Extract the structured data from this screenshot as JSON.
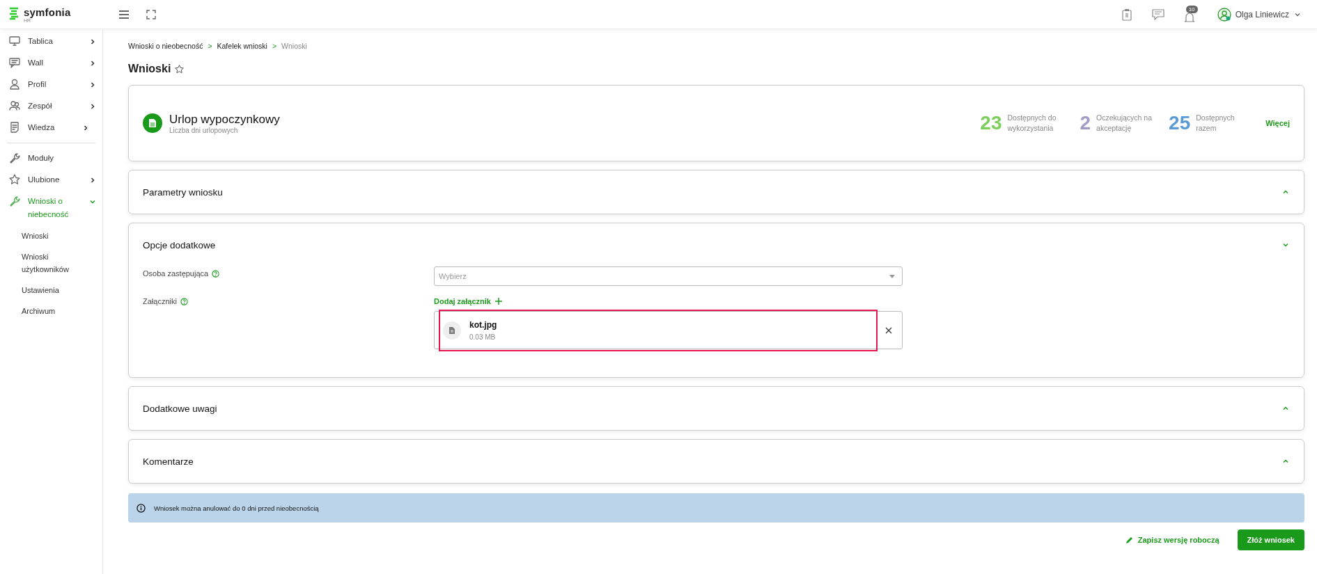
{
  "header": {
    "logo_text": "symfonia",
    "logo_sub": "HR",
    "notification_count": "10",
    "user_name": "Olga Liniewicz"
  },
  "sidebar": {
    "items": [
      {
        "label": "Tablica",
        "expandable": true,
        "expanded": false,
        "selected": false
      },
      {
        "label": "Wall",
        "expandable": true,
        "expanded": false,
        "selected": false
      },
      {
        "label": "Profil",
        "expandable": true,
        "expanded": false,
        "selected": false
      },
      {
        "label": "Zespół",
        "expandable": true,
        "expanded": false,
        "selected": false
      },
      {
        "label": "Wiedza",
        "expandable": true,
        "expanded": false,
        "selected": false,
        "divider_after": true
      },
      {
        "label": "Moduły",
        "expandable": false,
        "selected": false
      },
      {
        "label": "Ulubione",
        "expandable": true,
        "expanded": false,
        "selected": false
      },
      {
        "label": "Wnioski o niebecność",
        "expandable": true,
        "expanded": true,
        "selected": true,
        "children": [
          {
            "label": "Wnioski"
          },
          {
            "label": "Wnioski użytkowników"
          },
          {
            "label": "Ustawienia"
          },
          {
            "label": "Archiwum"
          }
        ]
      }
    ]
  },
  "breadcrumb": [
    {
      "label": "Wnioski o nieobecność",
      "current": false
    },
    {
      "separator": ">",
      "label": "Kafelek wnioski",
      "current": false
    },
    {
      "separator": ">",
      "label": "Wnioski",
      "current": true
    }
  ],
  "page_title": "Wnioski",
  "summary": {
    "title": "Urlop wypoczynkowy",
    "subtitle": "Liczba dni urlopowych",
    "stats": [
      {
        "value": "23",
        "label": "Dostępnych do wykorzystania",
        "color": "#7dce5a"
      },
      {
        "value": "2",
        "label": "Oczekujących na akceptację",
        "color": "#a29bc6"
      },
      {
        "value": "25",
        "label": "Dostępnych razem",
        "color": "#5b9bd5"
      }
    ],
    "more_link": "Więcej"
  },
  "sections": [
    {
      "kind": "collapsible",
      "title": "Parametry wniosku",
      "expanded": false
    },
    {
      "kind": "form",
      "title": "Opcje dodatkowe",
      "expanded": true,
      "fields": [
        {
          "kind": "select",
          "label": "Osoba zastępująca",
          "placeholder": "Wybierz"
        },
        {
          "kind": "attachments",
          "label": "Załączniki",
          "add_label": "Dodaj załącznik",
          "files": [
            {
              "name": "kot.jpg",
              "size": "0.03 MB",
              "highlighted": true
            }
          ]
        }
      ]
    },
    {
      "kind": "collapsible",
      "title": "Dodatkowe uwagi",
      "expanded": false
    },
    {
      "kind": "collapsible",
      "title": "Komentarze",
      "expanded": false
    }
  ],
  "info_message": "Wniosek można anulować do 0 dni przed nieobecnością",
  "actions": {
    "draft": "Zapisz wersję roboczą",
    "submit": "Złóż wniosek"
  }
}
